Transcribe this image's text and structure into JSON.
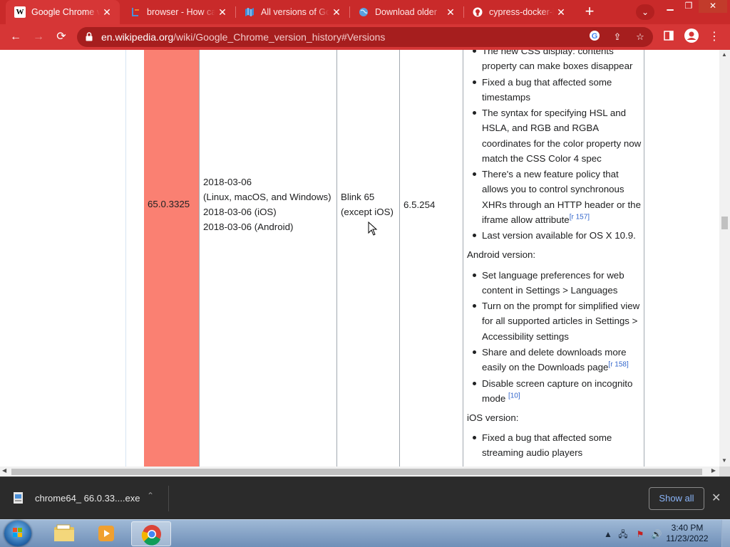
{
  "tabs": [
    {
      "title": "Google Chrome v",
      "icon": "wikipedia-icon",
      "active": true
    },
    {
      "title": "browser - How ca",
      "icon": "stackoverflow-icon",
      "active": false
    },
    {
      "title": "All versions of Go",
      "icon": "map-icon",
      "active": false
    },
    {
      "title": "Download older",
      "icon": "globe-icon",
      "active": false
    },
    {
      "title": "cypress-docker-i",
      "icon": "github-icon",
      "active": false
    }
  ],
  "address": {
    "host": "en.wikipedia.org",
    "path": "/wiki/Google_Chrome_version_history#Versions"
  },
  "table_row": {
    "version": "65.0.3325",
    "release_dates": [
      "2018-03-06",
      "(Linux, macOS, and Windows)",
      "2018-03-06 (iOS)",
      "2018-03-06 (Android)"
    ],
    "engine": [
      "Blink 65",
      "(except iOS)"
    ],
    "v8": "6.5.254"
  },
  "changes": {
    "desktop_items": [
      {
        "text": "The new CSS display: contents property can make boxes disappear",
        "ref": ""
      },
      {
        "text": "Fixed a bug that affected some timestamps",
        "ref": ""
      },
      {
        "text": "The syntax for specifying HSL and HSLA, and RGB and RGBA coordinates for the color property now match the CSS Color 4 spec",
        "ref": ""
      },
      {
        "text": "There's a new feature policy that allows you to control synchronous XHRs through an HTTP header or the iframe allow attribute",
        "ref": "[r 157]"
      },
      {
        "text": "Last version available for OS X 10.9.",
        "ref": ""
      }
    ],
    "android_heading": "Android version:",
    "android_items": [
      {
        "text": "Set language preferences for web content in Settings > Languages",
        "ref": ""
      },
      {
        "text": "Turn on the prompt for simplified view for all supported articles in Settings > Accessibility settings",
        "ref": ""
      },
      {
        "text": "Share and delete downloads more easily on the Downloads page",
        "ref": "[r 158]"
      },
      {
        "text": "Disable screen capture on incognito mode",
        "ref": "[10]"
      }
    ],
    "ios_heading": "iOS version:",
    "ios_items": [
      {
        "text": "Fixed a bug that affected some streaming audio players",
        "ref": ""
      }
    ]
  },
  "download_shelf": {
    "file_name": "chrome64_ 66.0.33....exe",
    "show_all": "Show all"
  },
  "taskbar": {
    "time": "3:40 PM",
    "date": "11/23/2022"
  },
  "colors": {
    "chrome_frame": "#c92a2a",
    "toolbar": "#d63636",
    "version_cell": "#fa8072",
    "link_blue": "#8ab4f8"
  }
}
